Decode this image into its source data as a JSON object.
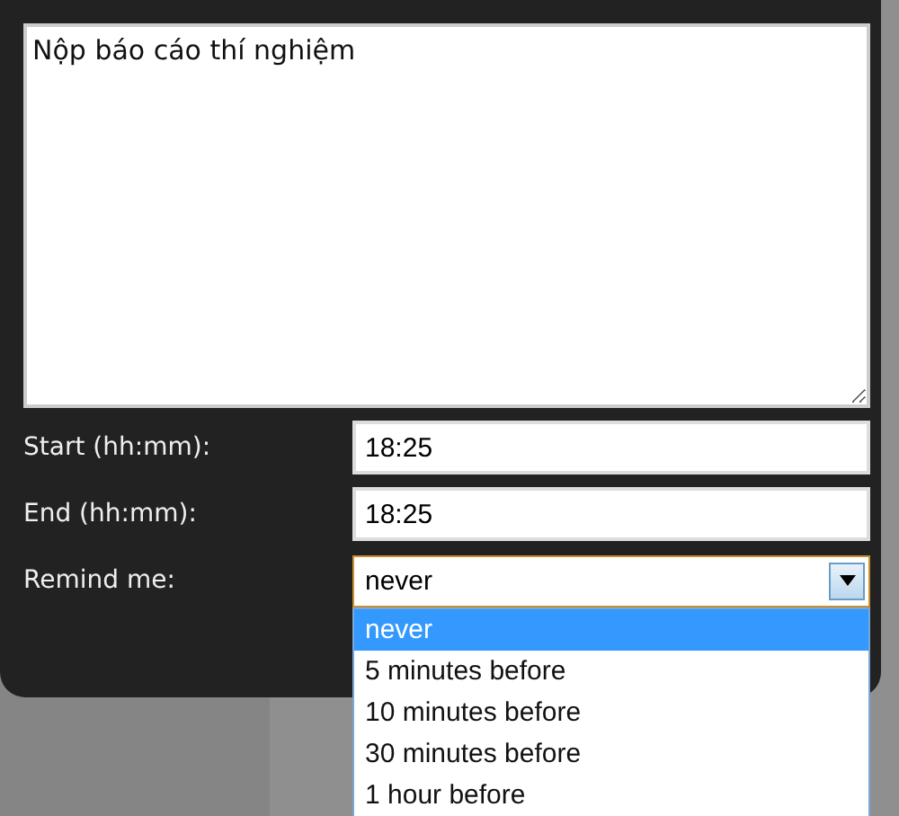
{
  "note": {
    "value": "Nộp báo cáo thí nghiệm"
  },
  "fields": [
    {
      "label": "Start (hh:mm):",
      "value": "18:25"
    },
    {
      "label": "End (hh:mm):",
      "value": "18:25"
    }
  ],
  "remind": {
    "label": "Remind me:",
    "value": "never",
    "expanded": true,
    "options": [
      {
        "label": "never",
        "selected": true
      },
      {
        "label": "5 minutes before",
        "selected": false
      },
      {
        "label": "10 minutes before",
        "selected": false
      },
      {
        "label": "30 minutes before",
        "selected": false
      },
      {
        "label": "1 hour before",
        "selected": false
      }
    ]
  }
}
